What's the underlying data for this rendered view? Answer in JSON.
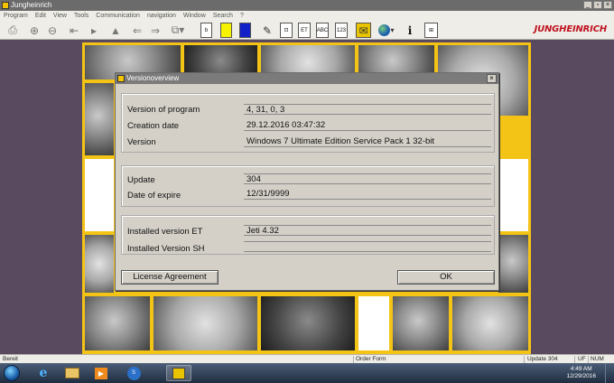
{
  "window": {
    "title": "Jungheinrich",
    "controls": [
      "_",
      "▫",
      "×"
    ]
  },
  "menu": [
    "Program",
    "Edit",
    "View",
    "Tools",
    "Communication",
    "navigation",
    "Window",
    "Search",
    "?"
  ],
  "toolbar": {
    "brand": "JUNGHEINRICH",
    "labels": {
      "b": "b",
      "et": "ET",
      "abc": "ABC",
      "num": "123"
    }
  },
  "dialog": {
    "title": "Versionoverview",
    "rows": {
      "program_label": "Version of program",
      "program_value": "4, 31, 0, 3",
      "creation_label": "Creation date",
      "creation_value": "29.12.2016 03:47:32",
      "version_label": "Version",
      "version_value": "Windows 7 Ultimate Edition Service Pack 1 32-bit",
      "update_label": "Update",
      "update_value": "304",
      "expire_label": "Date of expire",
      "expire_value": "12/31/9999",
      "et_label": "Installed version ET",
      "et_value": "Jeti 4.32",
      "sh_label": "Installed Version SH",
      "sh_value": ""
    },
    "license_button": "License Agreement",
    "ok_button": "OK"
  },
  "status": {
    "left": "Bereit",
    "order_form": "Order Form",
    "update": "Update 304",
    "uf": "UF",
    "num": "NUM"
  },
  "taskbar": {
    "time": "4:49 AM",
    "date": "12/29/2016"
  },
  "colors": {
    "mosaic_border": "#f3c316",
    "brand_red": "#c0121f",
    "background": "#5a4a5f"
  }
}
